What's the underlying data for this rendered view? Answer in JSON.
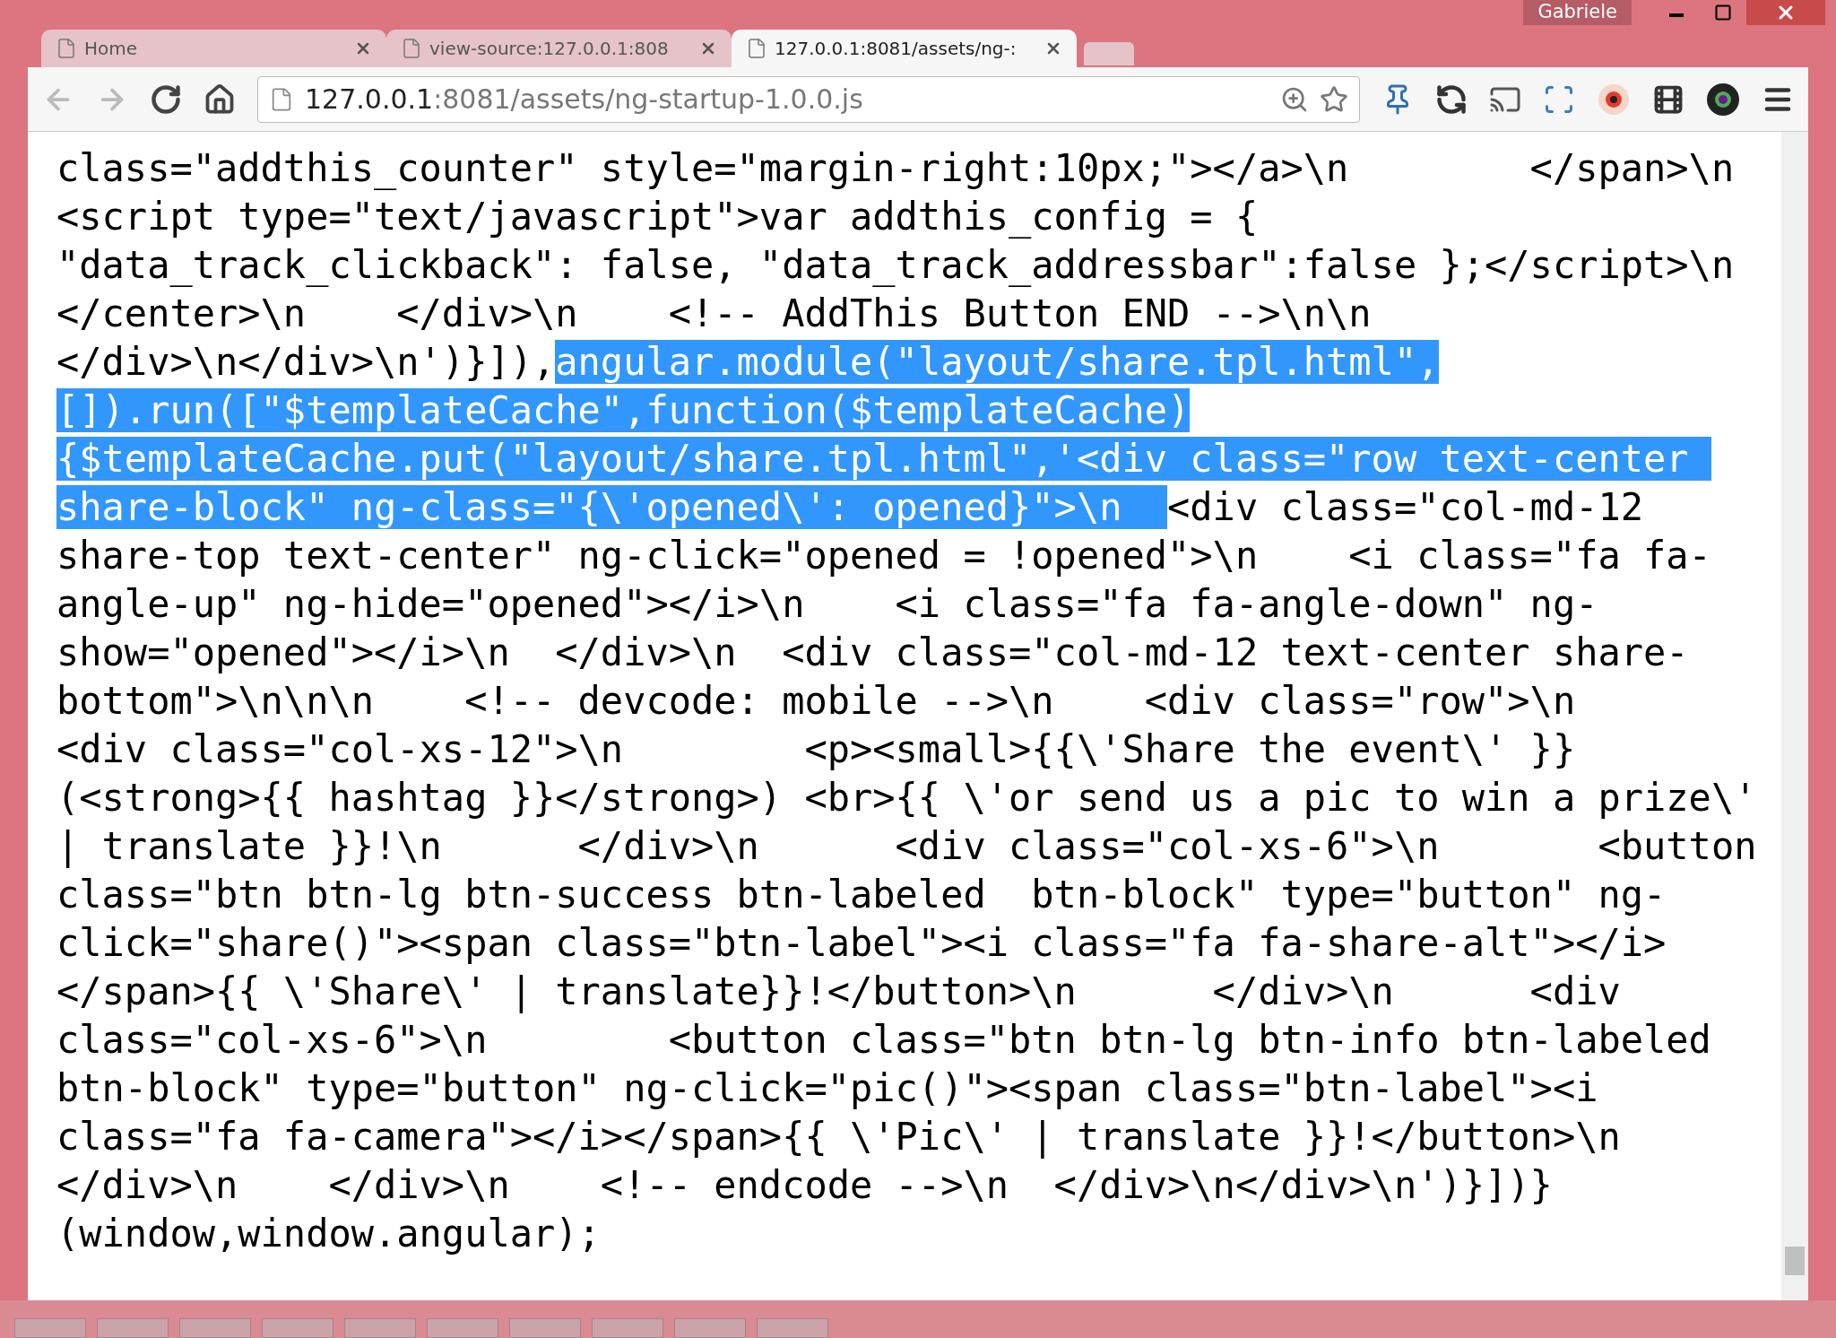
{
  "window": {
    "user": "Gabriele"
  },
  "tabs": [
    {
      "title": "Home",
      "selected": false
    },
    {
      "title": "view-source:127.0.0.1:808",
      "selected": false
    },
    {
      "title": "127.0.0.1:8081/assets/ng-:",
      "selected": true
    }
  ],
  "address_bar": {
    "host": "127.0.0.1",
    "path": ":8081/assets/ng-startup-1.0.0.js"
  },
  "code_lines": [
    {
      "segments": [
        {
          "text": "class=\"addthis_counter\" style=\"margin-right:10px;\"></a>\\n        </span>\\n",
          "selected": false
        }
      ]
    },
    {
      "segments": [
        {
          "text": "<script type=\"text/javascript\">var addthis_config = {",
          "selected": false
        }
      ]
    },
    {
      "segments": [
        {
          "text": "\"data_track_clickback\": false, \"data_track_addressbar\":false };</script>\\n",
          "selected": false
        }
      ]
    },
    {
      "segments": [
        {
          "text": "</center>\\n    </div>\\n    <!-- AddThis Button END -->\\n\\n",
          "selected": false
        }
      ]
    },
    {
      "segments": [
        {
          "text": "</div>\\n</div>\\n')}]),",
          "selected": false
        },
        {
          "text": "angular.module(\"layout/share.tpl.html\",",
          "selected": true
        }
      ]
    },
    {
      "segments": [
        {
          "text": "[]).run([\"$templateCache\",function($templateCache)",
          "selected": true
        }
      ]
    },
    {
      "segments": [
        {
          "text": "{$templateCache.put(\"layout/share.tpl.html\",'<div class=\"row text-center ",
          "selected": true
        }
      ]
    },
    {
      "segments": [
        {
          "text": "share-block\" ng-class=\"{\\'opened\\': opened}\">\\n  ",
          "selected": true
        },
        {
          "text": "<div class=\"col-md-12",
          "selected": false
        }
      ]
    },
    {
      "segments": [
        {
          "text": "share-top text-center\" ng-click=\"opened = !opened\">\\n    <i class=\"fa fa-",
          "selected": false
        }
      ]
    },
    {
      "segments": [
        {
          "text": "angle-up\" ng-hide=\"opened\"></i>\\n    <i class=\"fa fa-angle-down\" ng-",
          "selected": false
        }
      ]
    },
    {
      "segments": [
        {
          "text": "show=\"opened\"></i>\\n  </div>\\n  <div class=\"col-md-12 text-center share-",
          "selected": false
        }
      ]
    },
    {
      "segments": [
        {
          "text": "bottom\">\\n\\n\\n    <!-- devcode: mobile -->\\n    <div class=\"row\">\\n",
          "selected": false
        }
      ]
    },
    {
      "segments": [
        {
          "text": "<div class=\"col-xs-12\">\\n        <p><small>{{\\'Share the event\\' }}",
          "selected": false
        }
      ]
    },
    {
      "segments": [
        {
          "text": "(<strong>{{ hashtag }}</strong>) <br>{{ \\'or send us a pic to win a prize\\'",
          "selected": false
        }
      ]
    },
    {
      "segments": [
        {
          "text": "| translate }}!\\n      </div>\\n      <div class=\"col-xs-6\">\\n       <button",
          "selected": false
        }
      ]
    },
    {
      "segments": [
        {
          "text": "class=\"btn btn-lg btn-success btn-labeled  btn-block\" type=\"button\" ng-",
          "selected": false
        }
      ]
    },
    {
      "segments": [
        {
          "text": "click=\"share()\"><span class=\"btn-label\"><i class=\"fa fa-share-alt\"></i>",
          "selected": false
        }
      ]
    },
    {
      "segments": [
        {
          "text": "</span>{{ \\'Share\\' | translate}}!</button>\\n      </div>\\n      <div",
          "selected": false
        }
      ]
    },
    {
      "segments": [
        {
          "text": "class=\"col-xs-6\">\\n        <button class=\"btn btn-lg btn-info btn-labeled",
          "selected": false
        }
      ]
    },
    {
      "segments": [
        {
          "text": "btn-block\" type=\"button\" ng-click=\"pic()\"><span class=\"btn-label\"><i",
          "selected": false
        }
      ]
    },
    {
      "segments": [
        {
          "text": "class=\"fa fa-camera\"></i></span>{{ \\'Pic\\' | translate }}!</button>\\n",
          "selected": false
        }
      ]
    },
    {
      "segments": [
        {
          "text": "</div>\\n    </div>\\n    <!-- endcode -->\\n  </div>\\n</div>\\n')}])}",
          "selected": false
        }
      ]
    },
    {
      "segments": [
        {
          "text": "(window,window.angular);",
          "selected": false
        }
      ]
    }
  ]
}
